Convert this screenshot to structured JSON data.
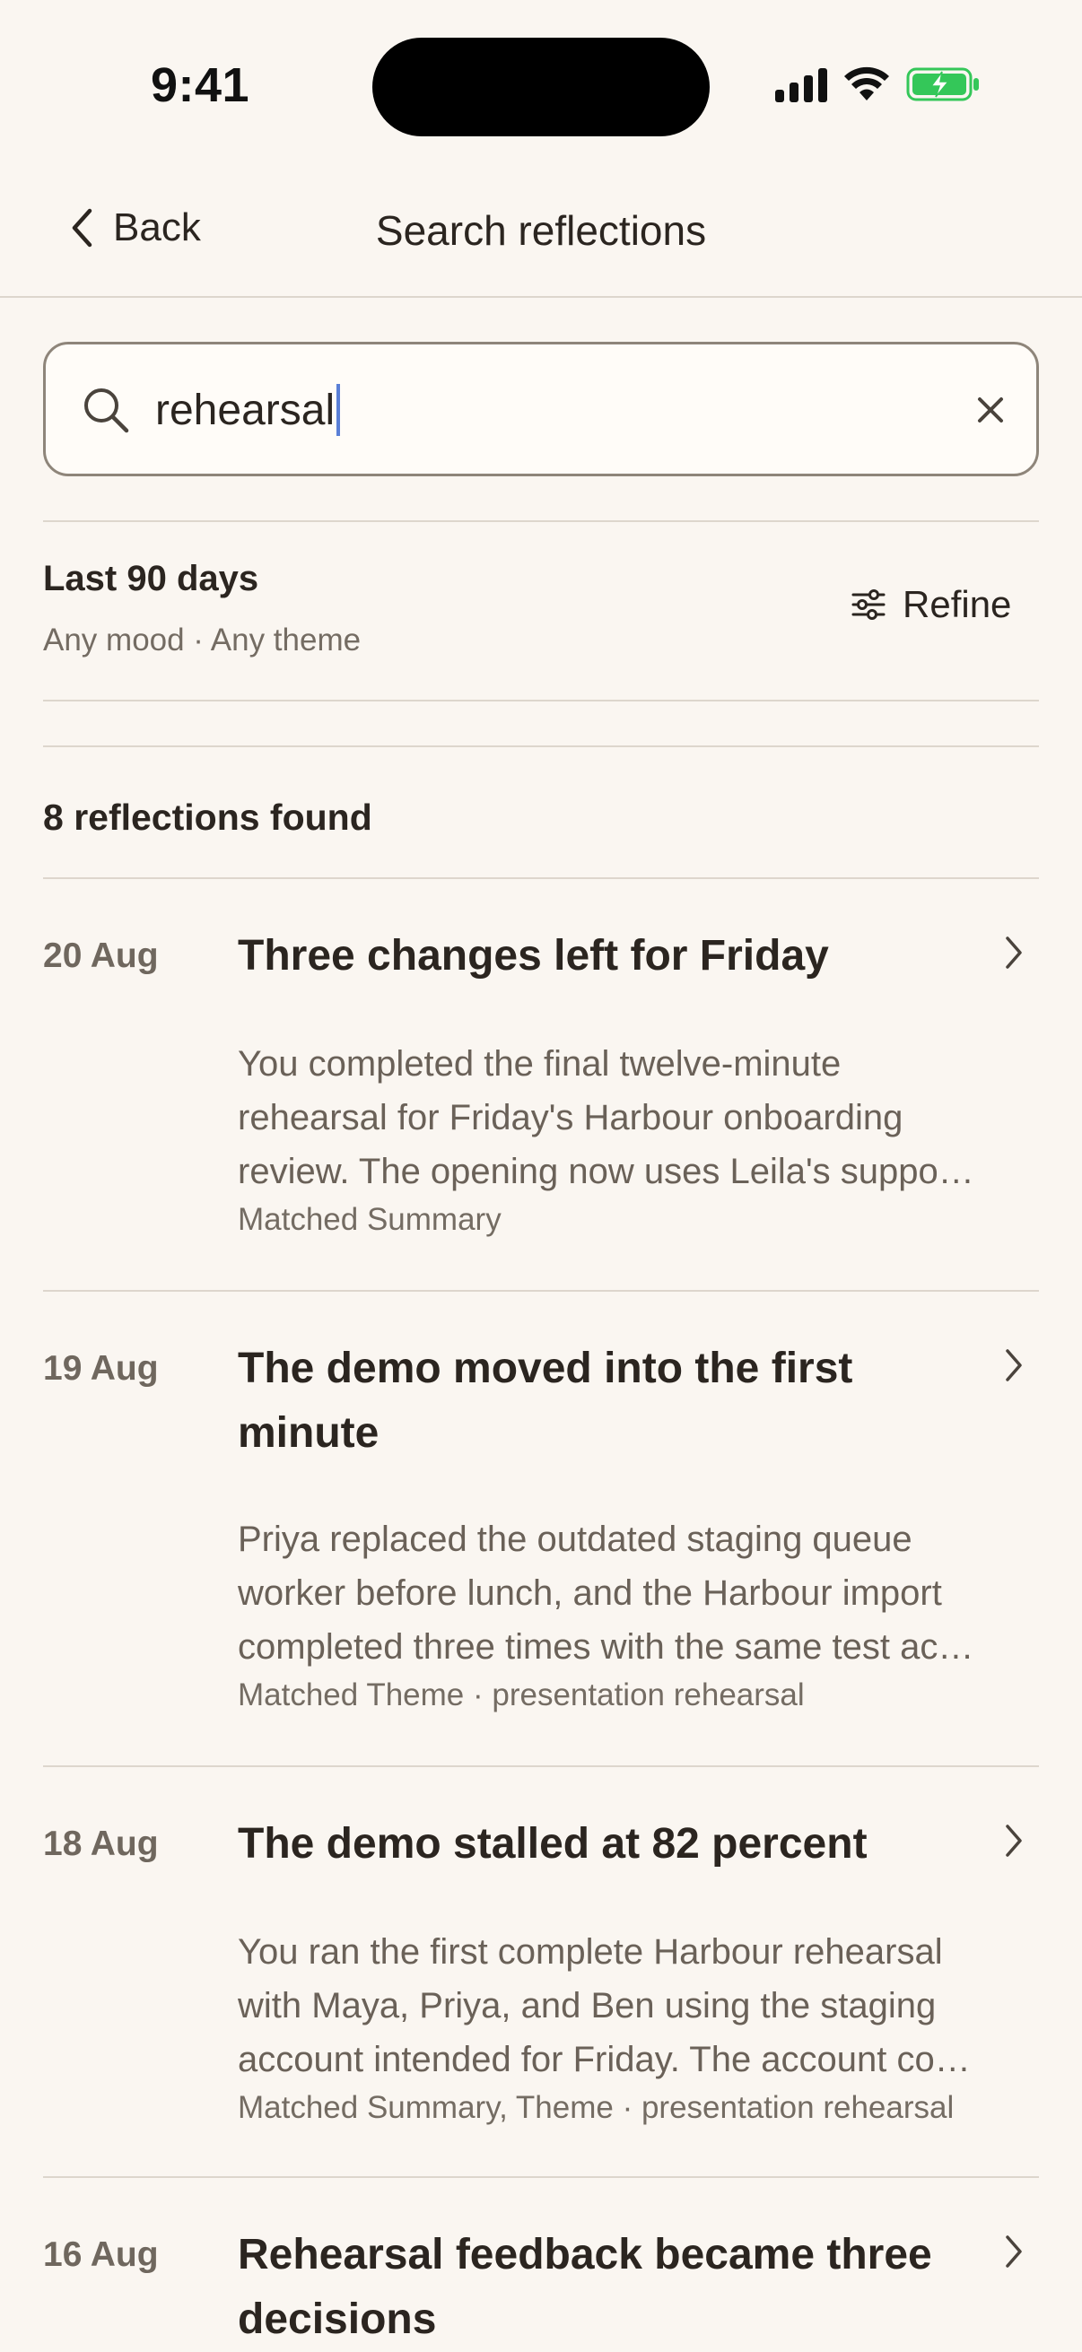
{
  "status_bar": {
    "time": "9:41"
  },
  "nav": {
    "back_label": "Back",
    "title": "Search reflections"
  },
  "search": {
    "value": "rehearsal"
  },
  "filter": {
    "range": "Last 90 days",
    "details": "Any mood · Any theme",
    "refine_label": "Refine"
  },
  "results": {
    "count_label": "8 reflections found",
    "items": [
      {
        "date": "20 Aug",
        "title_lines": [
          "Three changes left for Friday"
        ],
        "summary_lines": [
          "You completed the final twelve-minute",
          "rehearsal for Friday's Harbour onboarding",
          "review. The opening now uses Leila's suppo…"
        ],
        "match": "Matched Summary"
      },
      {
        "date": "19 Aug",
        "title_lines": [
          "The demo moved into the first",
          "minute"
        ],
        "summary_lines": [
          "Priya replaced the outdated staging queue",
          "worker before lunch, and the Harbour import",
          "completed three times with the same test ac…"
        ],
        "match": "Matched Theme · presentation rehearsal"
      },
      {
        "date": "18 Aug",
        "title_lines": [
          "The demo stalled at 82 percent"
        ],
        "summary_lines": [
          "You ran the first complete Harbour rehearsal",
          "with Maya, Priya, and Ben using the staging",
          "account intended for Friday. The account co…"
        ],
        "match": "Matched Summary, Theme · presentation rehearsal"
      },
      {
        "date": "16 Aug",
        "title_lines": [
          "Rehearsal feedback became three",
          "decisions"
        ],
        "summary_lines": [],
        "match": ""
      }
    ]
  },
  "colors": {
    "background": "#FAF6F1",
    "text_primary": "#2B2520",
    "text_secondary": "#6A6158",
    "divider": "#DDD6CD",
    "caret": "#5A7FD6",
    "battery_green": "#34C759"
  }
}
